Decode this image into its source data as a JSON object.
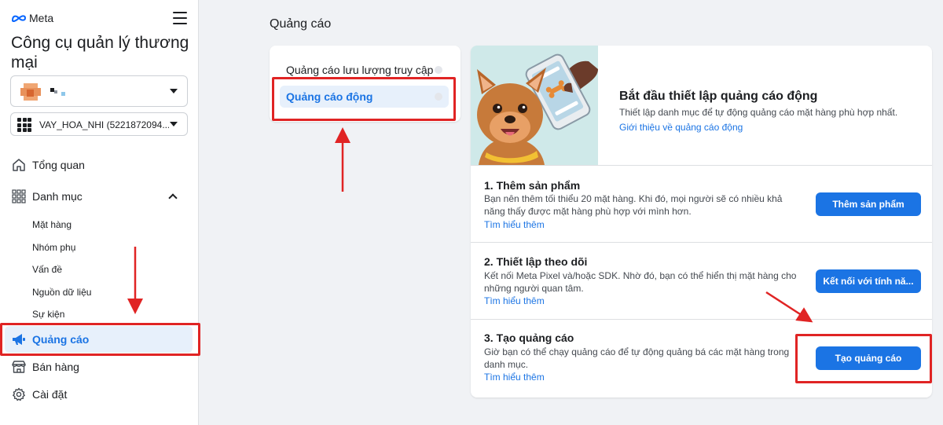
{
  "brand": {
    "logo_text": "Meta"
  },
  "sidebar": {
    "app_title": "Công cụ quản lý thương mại",
    "account_label": "■-",
    "catalog_label": "VAY_HOA_NHI (5221872094...",
    "items": [
      {
        "label": "Tổng quan",
        "icon": "home-icon"
      },
      {
        "label": "Danh mục",
        "icon": "catalog-grid-icon"
      },
      {
        "label": "Quảng cáo",
        "icon": "megaphone-icon"
      },
      {
        "label": "Bán hàng",
        "icon": "shop-icon"
      },
      {
        "label": "Cài đặt",
        "icon": "gear-icon"
      }
    ],
    "sub_items": [
      "Mặt hàng",
      "Nhóm phụ",
      "Vấn đề",
      "Nguồn dữ liệu",
      "Sự kiện"
    ]
  },
  "main": {
    "page_title": "Quảng cáo",
    "tabs": [
      {
        "label": "Quảng cáo lưu lượng truy cập"
      },
      {
        "label": "Quảng cáo động"
      }
    ],
    "hero": {
      "title": "Bắt đầu thiết lập quảng cáo động",
      "description": "Thiết lập danh mục để tự động quảng cáo mặt hàng phù hợp nhất.",
      "link": "Giới thiệu về quảng cáo động"
    },
    "steps": [
      {
        "title": "1. Thêm sản phẩm",
        "description": "Bạn nên thêm tối thiểu 20 mặt hàng. Khi đó, mọi người sẽ có nhiều khả năng thấy được mặt hàng phù hợp với mình hơn.",
        "link": "Tìm hiểu thêm",
        "button": "Thêm sản phẩm"
      },
      {
        "title": "2. Thiết lập theo dõi",
        "description": "Kết nối Meta Pixel và/hoặc SDK. Nhờ đó, bạn có thể hiển thị mặt hàng cho những người quan tâm.",
        "link": "Tìm hiểu thêm",
        "button": "Kết nối với tính nă..."
      },
      {
        "title": "3. Tạo quảng cáo",
        "description": "Giờ bạn có thể chạy quảng cáo để tự động quảng bá các mặt hàng trong danh mục.",
        "link": "Tìm hiểu thêm",
        "button": "Tạo quảng cáo"
      }
    ]
  },
  "colors": {
    "accent": "#1b74e4",
    "highlight": "#e02424",
    "active_bg": "#e7f0fb"
  }
}
